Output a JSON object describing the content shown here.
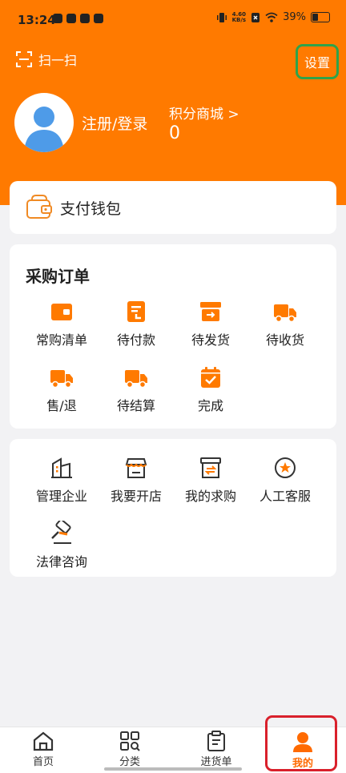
{
  "status_bar": {
    "time": "13:24",
    "net_speed_value": "4.60",
    "net_speed_unit": "KB/s",
    "battery": "39%"
  },
  "header": {
    "scan_label": "扫一扫",
    "settings_label": "设置",
    "login_label": "注册/登录",
    "points_mall_label": "积分商城 >",
    "points_value": "0"
  },
  "wallet": {
    "label": "支付钱包"
  },
  "orders": {
    "title": "采购订单",
    "items": [
      {
        "label": "常购清单",
        "icon": "frequent-list-icon"
      },
      {
        "label": "待付款",
        "icon": "pending-payment-icon"
      },
      {
        "label": "待发货",
        "icon": "pending-shipment-icon"
      },
      {
        "label": "待收货",
        "icon": "pending-receipt-icon"
      },
      {
        "label": "售/退",
        "icon": "after-sale-icon"
      },
      {
        "label": "待结算",
        "icon": "pending-settlement-icon"
      },
      {
        "label": "完成",
        "icon": "completed-icon"
      }
    ]
  },
  "services": {
    "items": [
      {
        "label": "管理企业",
        "icon": "enterprise-icon"
      },
      {
        "label": "我要开店",
        "icon": "open-store-icon"
      },
      {
        "label": "我的求购",
        "icon": "purchase-request-icon"
      },
      {
        "label": "人工客服",
        "icon": "customer-service-icon"
      },
      {
        "label": "法律咨询",
        "icon": "legal-consult-icon"
      }
    ]
  },
  "bottom_nav": {
    "items": [
      {
        "label": "首页",
        "icon": "home-icon"
      },
      {
        "label": "分类",
        "icon": "category-icon"
      },
      {
        "label": "进货单",
        "icon": "order-list-icon"
      },
      {
        "label": "我的",
        "icon": "profile-icon"
      }
    ],
    "active": "我的"
  },
  "colors": {
    "brand_orange": "#ff7a00",
    "settings_highlight": "#2fa34a",
    "active_highlight": "#d9202b"
  }
}
